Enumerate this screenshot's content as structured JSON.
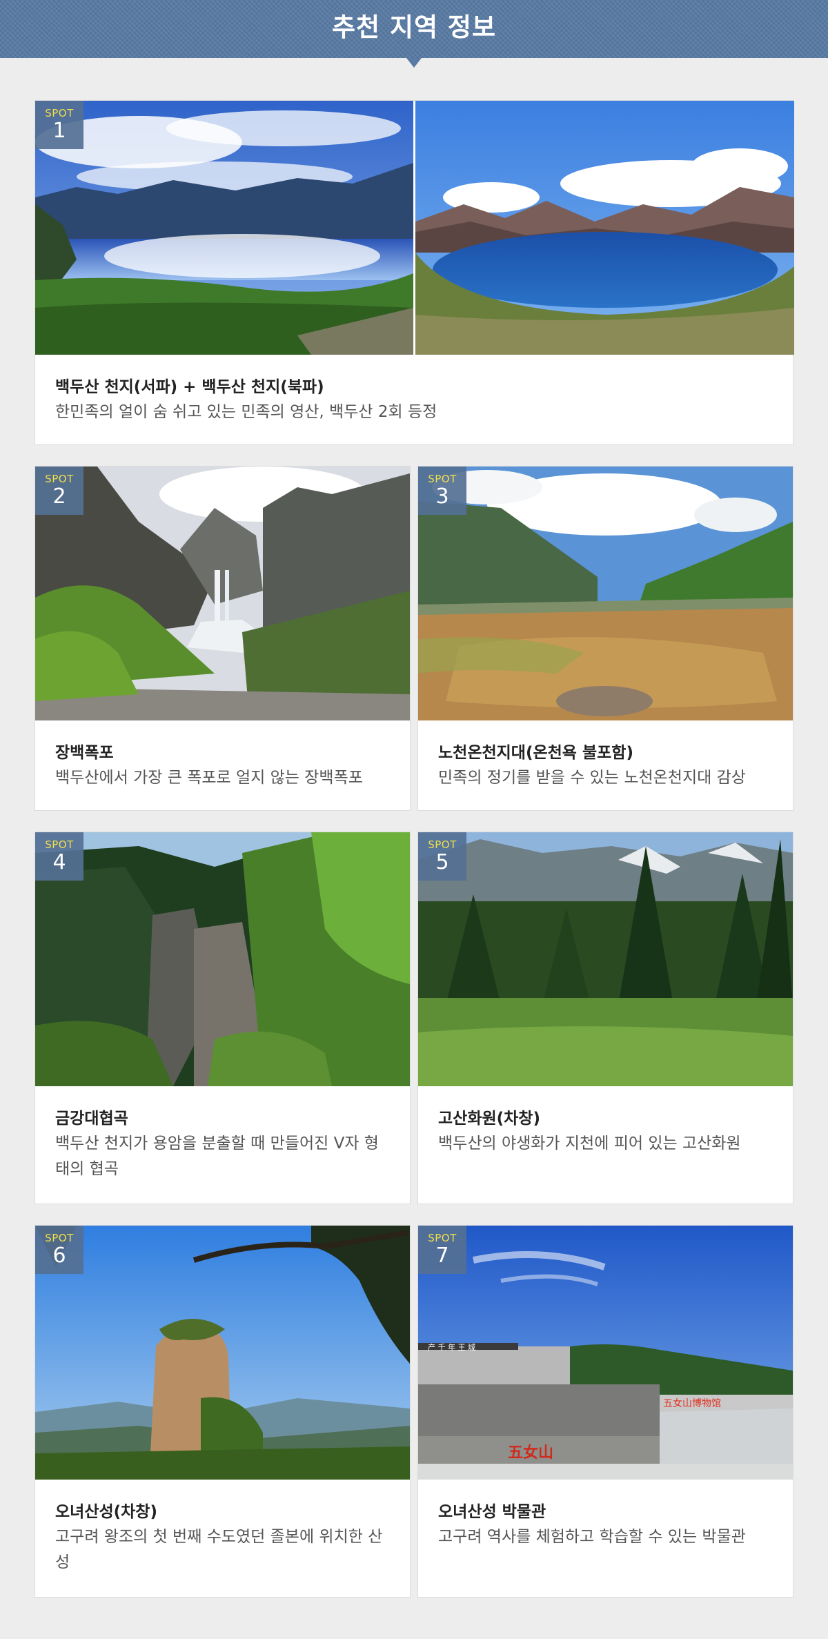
{
  "header": {
    "title": "추천 지역 정보"
  },
  "spot_label": "SPOT",
  "spots": [
    {
      "number": "1",
      "title": "백두산 천지(서파) + 백두산 천지(북파)",
      "description": "한민족의 얼이 숨 쉬고 있는 민족의 영산, 백두산 2회 등정"
    },
    {
      "number": "2",
      "title": "장백폭포",
      "description": "백두산에서 가장 큰 폭포로 얼지 않는 장백폭포"
    },
    {
      "number": "3",
      "title": "노천온천지대(온천욕 불포함)",
      "description": "민족의 정기를 받을 수 있는 노천온천지대 감상"
    },
    {
      "number": "4",
      "title": "금강대협곡",
      "description": "백두산 천지가 용암을 분출할 때 만들어진 V자 형태의 협곡"
    },
    {
      "number": "5",
      "title": "고산화원(차창)",
      "description": "백두산의 야생화가 지천에 피어 있는 고산화원"
    },
    {
      "number": "6",
      "title": "오녀산성(차창)",
      "description": "고구려 왕조의 첫 번째 수도였던 졸본에 위치한 산성"
    },
    {
      "number": "7",
      "title": "오녀산성 박물관",
      "description": "고구려 역사를 체험하고 학습할 수 있는 박물관"
    }
  ],
  "photo_signs": {
    "museum_roof": "产 千 年 王 城",
    "museum_banner": "五女山博物馆",
    "museum_stone": "五女山"
  },
  "colors": {
    "header": "#587aa3",
    "badge": "#547094",
    "badge_label": "#f2df4a"
  }
}
